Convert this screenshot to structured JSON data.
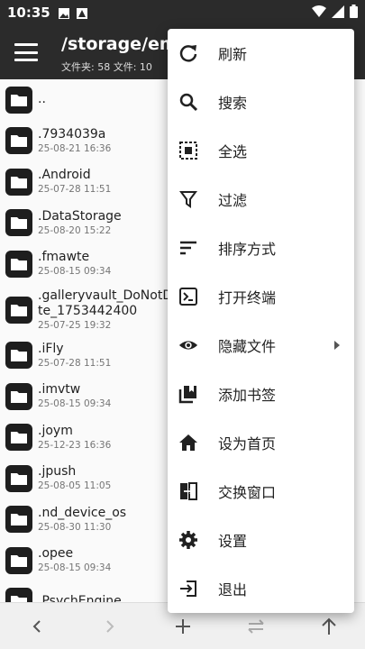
{
  "status": {
    "time": "10:35"
  },
  "appbar": {
    "path": "/storage/emu",
    "counts": "文件夹: 58  文件: 10"
  },
  "files": [
    {
      "name": "..",
      "date": ""
    },
    {
      "name": ".7934039a",
      "date": "25-08-21 16:36"
    },
    {
      "name": ".Android",
      "date": "25-07-28 11:51"
    },
    {
      "name": ".DataStorage",
      "date": "25-08-20 15:22"
    },
    {
      "name": ".fmawte",
      "date": "25-08-15 09:34"
    },
    {
      "name": ".galleryvault_DoNotDe",
      "name2": "te_1753442400",
      "date": "25-07-25 19:32"
    },
    {
      "name": ".iFly",
      "date": "25-07-28 11:51"
    },
    {
      "name": ".imvtw",
      "date": "25-08-15 09:34"
    },
    {
      "name": ".joym",
      "date": "25-12-23 16:36"
    },
    {
      "name": ".jpush",
      "date": "25-08-05 11:05"
    },
    {
      "name": ".nd_device_os",
      "date": "25-08-30 11:30"
    },
    {
      "name": ".opee",
      "date": "25-08-15 09:34"
    },
    {
      "name": ".PsychEngine",
      "date": ""
    }
  ],
  "menu": {
    "refresh": "刷新",
    "search": "搜索",
    "select_all": "全选",
    "filter": "过滤",
    "sort": "排序方式",
    "terminal": "打开终端",
    "hidden_files": "隐藏文件",
    "add_bookmark": "添加书签",
    "set_home": "设为首页",
    "swap_window": "交换窗口",
    "settings": "设置",
    "exit": "退出"
  }
}
